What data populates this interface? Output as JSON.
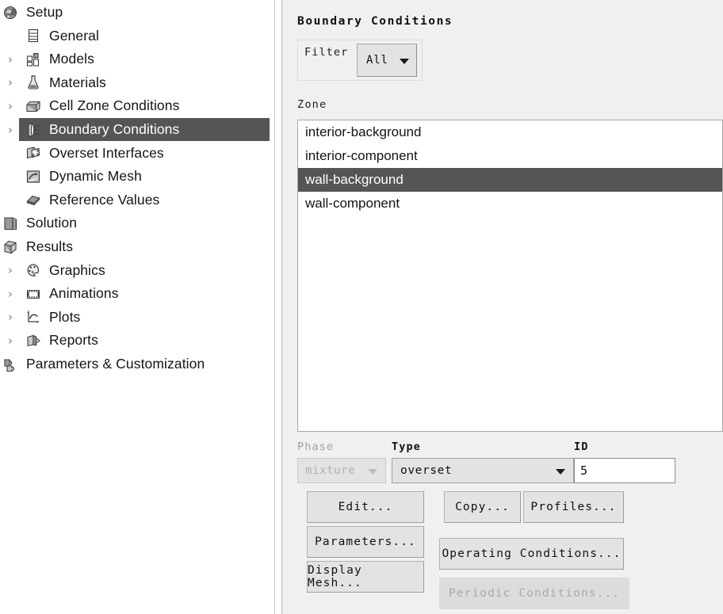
{
  "tree": {
    "items": [
      {
        "label": "Setup",
        "level": 0,
        "icon": "setup-icon",
        "arrow": false,
        "selected": false
      },
      {
        "label": "General",
        "level": 1,
        "icon": "general-icon",
        "arrow": false,
        "selected": false
      },
      {
        "label": "Models",
        "level": 1,
        "icon": "models-icon",
        "arrow": true,
        "selected": false
      },
      {
        "label": "Materials",
        "level": 1,
        "icon": "materials-icon",
        "arrow": true,
        "selected": false
      },
      {
        "label": "Cell Zone Conditions",
        "level": 1,
        "icon": "cell-zone-conditions-icon",
        "arrow": true,
        "selected": false
      },
      {
        "label": "Boundary Conditions",
        "level": 1,
        "icon": "boundary-conditions-icon",
        "arrow": true,
        "selected": true
      },
      {
        "label": "Overset Interfaces",
        "level": 1,
        "icon": "overset-interfaces-icon",
        "arrow": false,
        "selected": false
      },
      {
        "label": "Dynamic Mesh",
        "level": 1,
        "icon": "dynamic-mesh-icon",
        "arrow": false,
        "selected": false
      },
      {
        "label": "Reference Values",
        "level": 1,
        "icon": "reference-values-icon",
        "arrow": false,
        "selected": false
      },
      {
        "label": "Solution",
        "level": 0,
        "icon": "solution-icon",
        "arrow": false,
        "selected": false
      },
      {
        "label": "Results",
        "level": 0,
        "icon": "results-icon",
        "arrow": false,
        "selected": false
      },
      {
        "label": "Graphics",
        "level": 1,
        "icon": "graphics-icon",
        "arrow": true,
        "selected": false
      },
      {
        "label": "Animations",
        "level": 1,
        "icon": "animations-icon",
        "arrow": true,
        "selected": false
      },
      {
        "label": "Plots",
        "level": 1,
        "icon": "plots-icon",
        "arrow": true,
        "selected": false
      },
      {
        "label": "Reports",
        "level": 1,
        "icon": "reports-icon",
        "arrow": true,
        "selected": false
      },
      {
        "label": "Parameters & Customization",
        "level": 0,
        "icon": "parameters-icon",
        "arrow": false,
        "selected": false
      }
    ]
  },
  "panel": {
    "title": "Boundary Conditions",
    "filter": {
      "label": "Filter",
      "selected": "All"
    },
    "zone": {
      "label": "Zone",
      "items": [
        {
          "name": "interior-background",
          "selected": false
        },
        {
          "name": "interior-component",
          "selected": false
        },
        {
          "name": "wall-background",
          "selected": true
        },
        {
          "name": "wall-component",
          "selected": false
        }
      ]
    },
    "phase": {
      "label": "Phase",
      "selected": "mixture",
      "disabled": true
    },
    "type": {
      "label": "Type",
      "selected": "overset"
    },
    "id": {
      "label": "ID",
      "value": "5"
    },
    "buttons": {
      "edit": "Edit...",
      "parameters": "Parameters...",
      "display_mesh": "Display Mesh...",
      "copy": "Copy...",
      "profiles": "Profiles...",
      "operating_conditions": "Operating Conditions...",
      "periodic_conditions": "Periodic Conditions..."
    }
  },
  "colors": {
    "selection": "#555555",
    "panel_bg": "#f0f0f0",
    "list_bg": "#ffffff",
    "button_bg": "#e3e3e3",
    "disabled_text": "#ababab"
  }
}
